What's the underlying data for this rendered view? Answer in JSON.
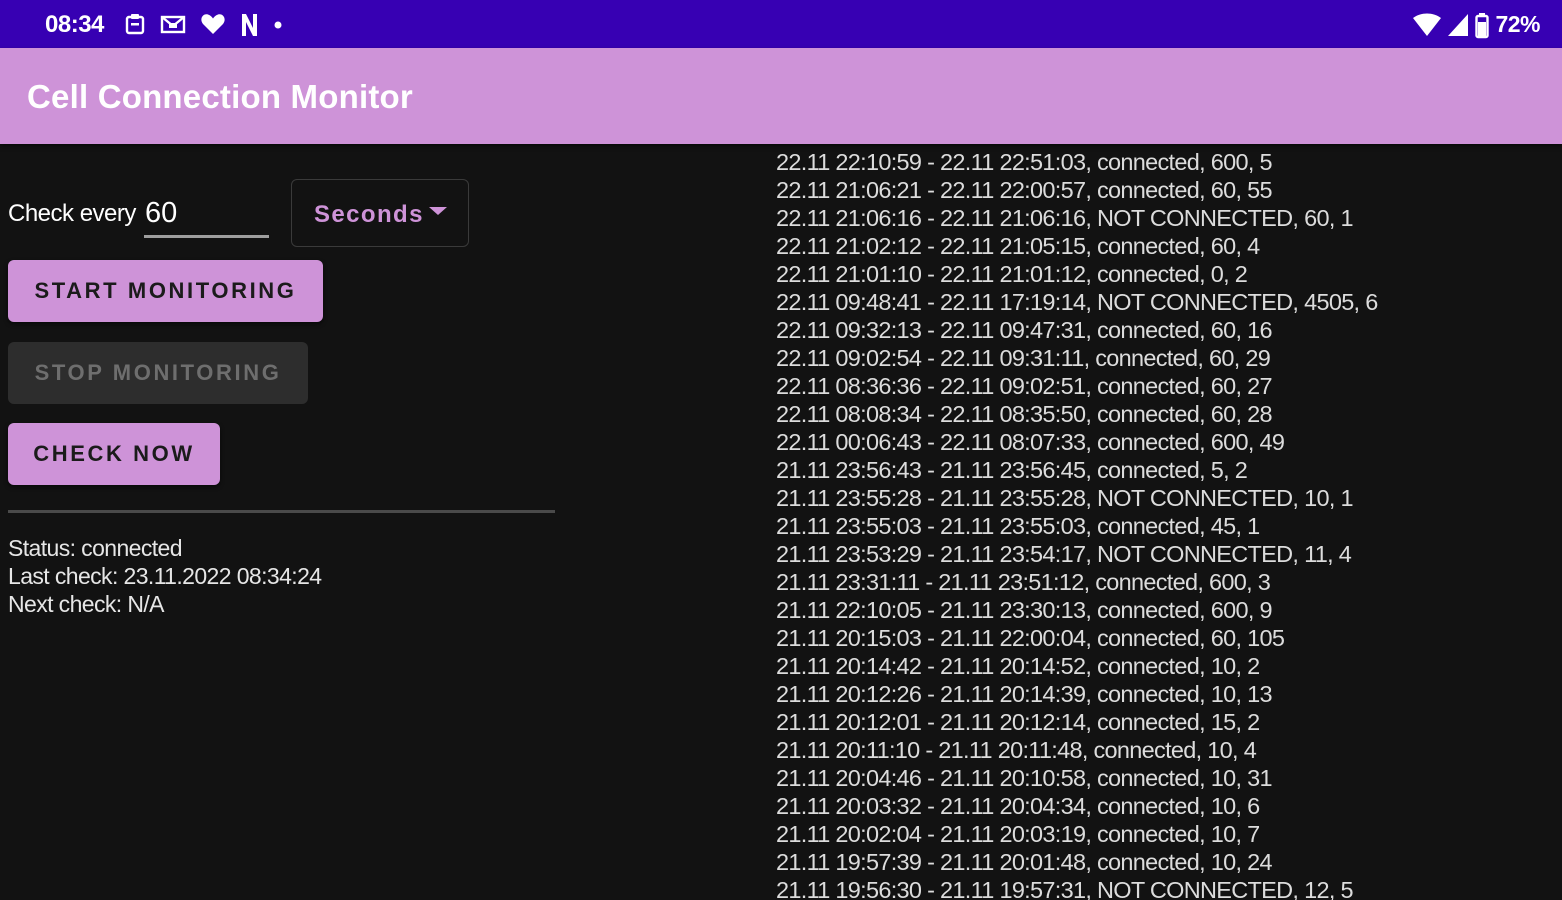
{
  "status_bar": {
    "time": "08:34",
    "left_icons": [
      "notification-clipboard-icon",
      "notification-mail-icon",
      "heart-icon",
      "n-app-icon",
      "dot-icon"
    ],
    "right_icons": [
      "wifi-icon",
      "cell-signal-icon",
      "battery-icon"
    ],
    "battery": "72%"
  },
  "app_bar": {
    "title": "Cell Connection Monitor"
  },
  "controls": {
    "check_every_label": "Check every",
    "interval_value": "60",
    "unit_selected": "Seconds",
    "start_label": "START MONITORING",
    "stop_label": "STOP MONITORING",
    "check_now_label": "CHECK NOW"
  },
  "status": {
    "status_line": "Status: connected",
    "last_check_line": "Last check: 23.11.2022 08:34:24",
    "next_check_line": "Next check: N/A"
  },
  "log": [
    "22.11 22:10:59 - 22.11 22:51:03, connected, 600, 5",
    "22.11 21:06:21 - 22.11 22:00:57, connected, 60, 55",
    "22.11 21:06:16 - 22.11 21:06:16, NOT CONNECTED, 60, 1",
    "22.11 21:02:12 - 22.11 21:05:15, connected, 60, 4",
    "22.11 21:01:10 - 22.11 21:01:12, connected, 0, 2",
    "22.11 09:48:41 - 22.11 17:19:14, NOT CONNECTED, 4505, 6",
    "22.11 09:32:13 - 22.11 09:47:31, connected, 60, 16",
    "22.11 09:02:54 - 22.11 09:31:11, connected, 60, 29",
    "22.11 08:36:36 - 22.11 09:02:51, connected, 60, 27",
    "22.11 08:08:34 - 22.11 08:35:50, connected, 60, 28",
    "22.11 00:06:43 - 22.11 08:07:33, connected, 600, 49",
    "21.11 23:56:43 - 21.11 23:56:45, connected, 5, 2",
    "21.11 23:55:28 - 21.11 23:55:28, NOT CONNECTED, 10, 1",
    "21.11 23:55:03 - 21.11 23:55:03, connected, 45, 1",
    "21.11 23:53:29 - 21.11 23:54:17, NOT CONNECTED, 11, 4",
    "21.11 23:31:11 - 21.11 23:51:12, connected, 600, 3",
    "21.11 22:10:05 - 21.11 23:30:13, connected, 600, 9",
    "21.11 20:15:03 - 21.11 22:00:04, connected, 60, 105",
    "21.11 20:14:42 - 21.11 20:14:52, connected, 10, 2",
    "21.11 20:12:26 - 21.11 20:14:39, connected, 10, 13",
    "21.11 20:12:01 - 21.11 20:12:14, connected, 15, 2",
    "21.11 20:11:10 - 21.11 20:11:48, connected, 10, 4",
    "21.11 20:04:46 - 21.11 20:10:58, connected, 10, 31",
    "21.11 20:03:32 - 21.11 20:04:34, connected, 10, 6",
    "21.11 20:02:04 - 21.11 20:03:19, connected, 10, 7",
    "21.11 19:57:39 - 21.11 20:01:48, connected, 10, 24",
    "21.11 19:56:30 - 21.11 19:57:31, NOT CONNECTED, 12, 5"
  ],
  "colors": {
    "status_bar": "#3700b3",
    "app_bar": "#ce93d8",
    "background": "#121212",
    "accent": "#ce93d8",
    "disabled_button": "#2d2d2d"
  }
}
